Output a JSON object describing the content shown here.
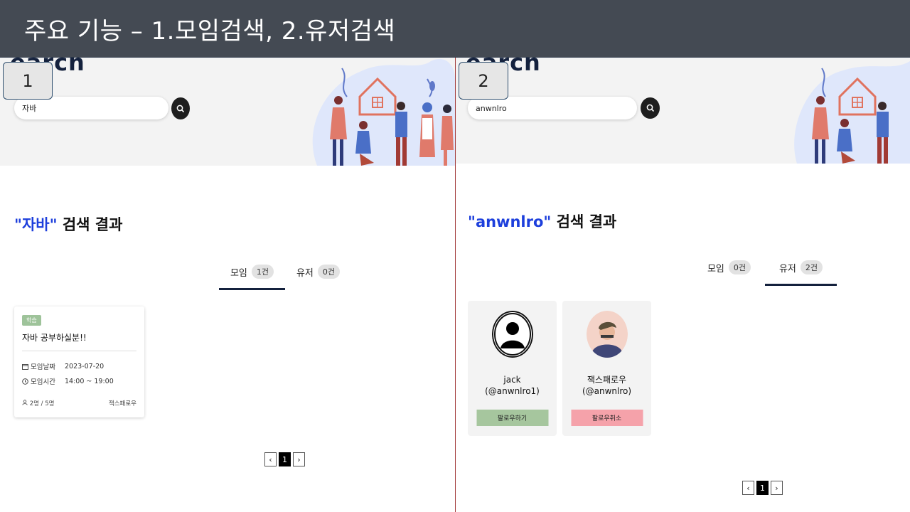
{
  "slide": {
    "title": "주요 기능 – 1.모임검색, 2.유저검색"
  },
  "panel1": {
    "number": "1",
    "logo": "earch",
    "search": {
      "value": "자바"
    },
    "result": {
      "query": "\"자바\"",
      "suffix": " 검색 결과"
    },
    "tabs": [
      {
        "label": "모임",
        "count": "1건",
        "active": true
      },
      {
        "label": "유저",
        "count": "0건",
        "active": false
      }
    ],
    "meeting_card": {
      "tag": "학습",
      "title": "자바 공부하실분!!",
      "date_label": "모임날짜",
      "date_value": "2023-07-20",
      "time_label": "모임시간",
      "time_value": "14:00 ~ 19:00",
      "members": "2명 / 5명",
      "host": "잭스패로우"
    },
    "pager": {
      "prev": "‹",
      "page": "1",
      "next": "›"
    }
  },
  "panel2": {
    "number": "2",
    "logo": "earch",
    "search": {
      "value": "anwnlro"
    },
    "result": {
      "query": "\"anwnlro\"",
      "suffix": " 검색 결과"
    },
    "tabs": [
      {
        "label": "모임",
        "count": "0건",
        "active": false
      },
      {
        "label": "유저",
        "count": "2건",
        "active": true
      }
    ],
    "users": [
      {
        "name": "jack",
        "handle": "(@anwnlro1)",
        "button": "팔로우하기",
        "button_color": "#a6c69e"
      },
      {
        "name": "잭스패로우",
        "handle": "(@anwnlro)",
        "button": "팔로우취소",
        "button_color": "#f5a2aa"
      }
    ],
    "pager": {
      "prev": "‹",
      "page": "1",
      "next": "›"
    }
  },
  "colors": {
    "title_bar": "#444a53",
    "query_blue": "#1d3fdc",
    "tab_underline": "#14213d",
    "divider": "#a23a3a"
  }
}
